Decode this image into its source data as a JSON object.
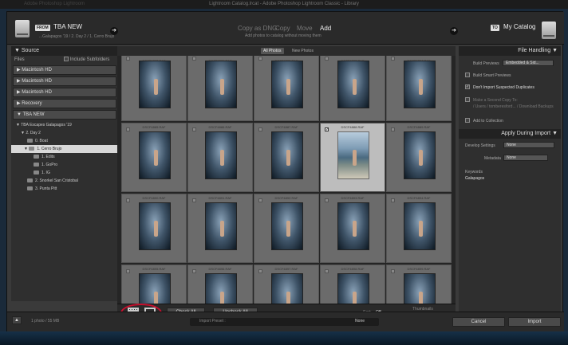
{
  "window": {
    "title": "Lightroom Catalog.lrcat - Adobe Photoshop Lightroom Classic - Library",
    "behind_title": "Adobe Photoshop Lightroom"
  },
  "header": {
    "from_tag": "FROM",
    "source_name": "TBA NEW",
    "breadcrumb": "...Galapagos '19 / 2. Day 2 / 1. Cerro Brujo",
    "modes": [
      "Copy as DNG",
      "Copy",
      "Move",
      "Add"
    ],
    "active_mode": "Add",
    "mode_subtitle": "Add photos to catalog without moving them",
    "to_tag": "TO",
    "dest_name": "My Catalog"
  },
  "source": {
    "title": "Source",
    "files_label": "Files",
    "include_subfolders": "Include Subfolders",
    "drives": [
      "Macintosh HD",
      "Macintosh HD",
      "Macintosh HD",
      "Recovery",
      "TBA NEW"
    ],
    "tree": [
      "TBA Escapes Galapagos '19",
      "2. Day 2",
      "0. Boat",
      "1. Cerro Brujo",
      "1. Edits",
      "1. GoPro",
      "1. IG",
      "2. Snorkel San Cristobal",
      "3. Punta Pitt"
    ]
  },
  "grid": {
    "tabs": [
      "All Photos",
      "New Photos"
    ],
    "rows": [
      [
        "DSCF4880.RAF",
        "DSCF4881.RAF",
        "DSCF4882.RAF",
        "DSCF4883.RAF",
        "DSCF4884.RAF"
      ],
      [
        "DSCF4885.RAF",
        "DSCF4886.RAF",
        "DSCF4887.RAF",
        "DSCF4888.RAF",
        "DSCF4889.RAF"
      ],
      [
        "DSCF4890.RAF",
        "DSCF4891.RAF",
        "DSCF4892.RAF",
        "DSCF4893.RAF",
        "DSCF4894.RAF"
      ],
      [
        "DSCF4895.RAF",
        "DSCF4896.RAF",
        "DSCF4897.RAF",
        "DSCF4898.RAF",
        "DSCF4899.RAF"
      ]
    ],
    "selected_filename": "DSCF4891.RAF"
  },
  "toolbar": {
    "check_all": "Check All",
    "uncheck_all": "Uncheck All",
    "sort_label": "Sort:",
    "sort_value": "Off",
    "thumbnails_label": "Thumbnails"
  },
  "file_handling": {
    "title": "File Handling",
    "build_previews_label": "Build Previews",
    "build_previews_value": "Embedded & Sid...",
    "build_smart": "Build Smart Previews",
    "dont_import": "Don't Import Suspected Duplicates",
    "second_copy": "Make a Second Copy To:",
    "second_copy_path": "/ Users / tomberesford... / Download Backups",
    "add_to_collection": "Add to Collection"
  },
  "apply": {
    "title": "Apply During Import",
    "develop_label": "Develop Settings",
    "develop_value": "None",
    "metadata_label": "Metadata",
    "metadata_value": "None",
    "keywords_label": "Keywords",
    "keywords_value": "Galapagos"
  },
  "footer": {
    "status": "1 photo / 55 MB",
    "preset_label": "Import Preset :",
    "preset_value": "None",
    "cancel": "Cancel",
    "import": "Import"
  }
}
